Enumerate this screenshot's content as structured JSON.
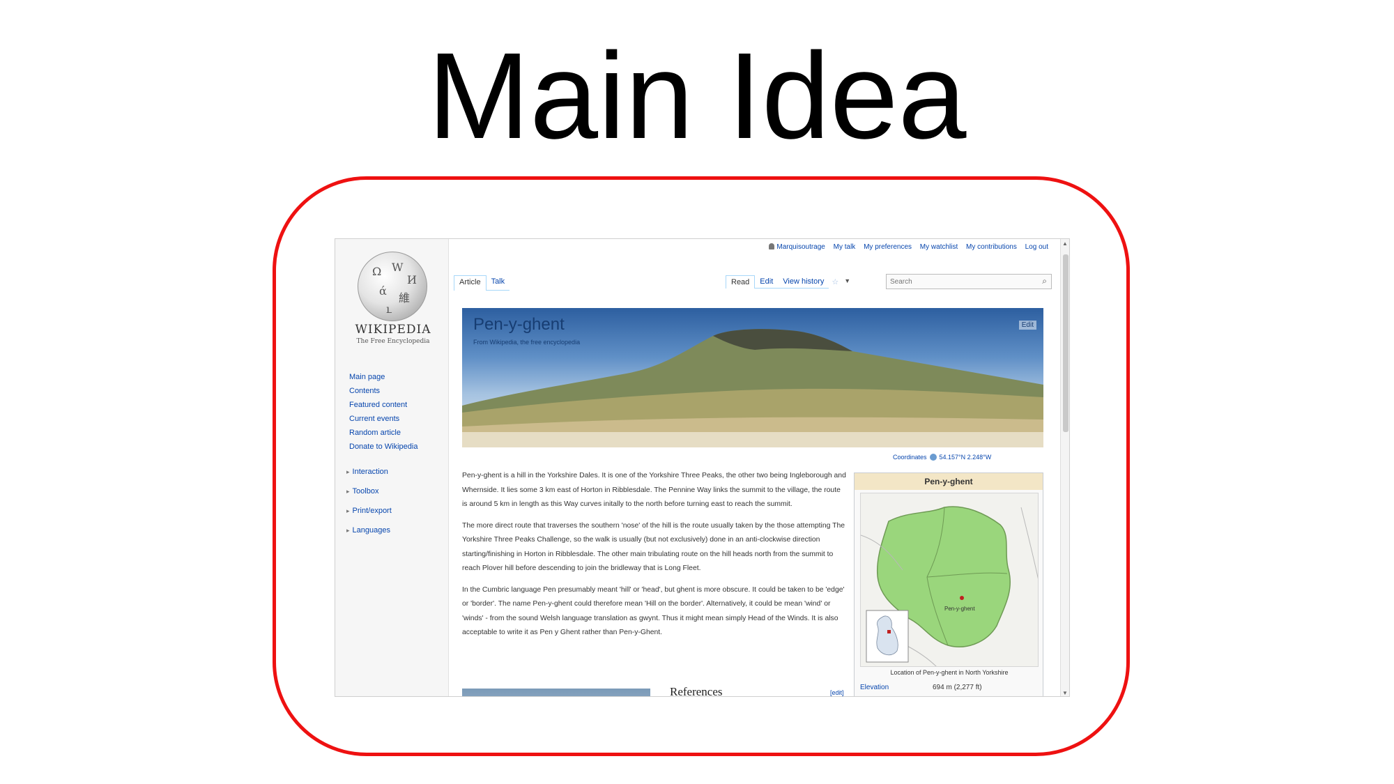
{
  "slide": {
    "title": "Main Idea"
  },
  "sidebar": {
    "logo_word": "WIKIPEDIA",
    "logo_tagline": "The Free Encyclopedia",
    "nav": [
      "Main page",
      "Contents",
      "Featured content",
      "Current events",
      "Random article",
      "Donate to Wikipedia"
    ],
    "portlets": [
      "Interaction",
      "Toolbox",
      "Print/export",
      "Languages"
    ]
  },
  "personal": [
    "Marquisoutrage",
    "My talk",
    "My preferences",
    "My watchlist",
    "My contributions",
    "Log out"
  ],
  "tabs": {
    "article": "Article",
    "talk": "Talk",
    "read": "Read",
    "edit": "Edit",
    "history": "View history"
  },
  "search": {
    "placeholder": "Search"
  },
  "banner": {
    "title": "Pen-y-ghent",
    "subtitle": "From Wikipedia, the free encyclopedia",
    "edit": "Edit"
  },
  "coords": {
    "label": "Coordinates",
    "value": "54.157°N 2.248°W"
  },
  "article": {
    "paragraphs": [
      "Pen-y-ghent is a hill in the Yorkshire Dales. It is one of the Yorkshire Three Peaks, the other two being Ingleborough and Whernside. It lies some 3 km east of Horton in Ribblesdale. The Pennine Way links the summit to the village, the route is around 5 km in length as this Way curves initally to the north before turning east to reach the summit.",
      "The more direct route that traverses the southern 'nose' of the hill is the route usually taken by the those attempting The Yorkshire Three Peaks Challenge, so the walk is usually (but not exclusively) done in an anti-clockwise direction starting/finishing in Horton in Ribblesdale. The other main tribulating route on the hill heads north from the summit to reach Plover hill before descending to join the bridleway that is Long Fleet.",
      "In the Cumbric language Pen presumably meant 'hill' or 'head', but ghent is more obscure. It could be taken to be 'edge' or 'border'. The name Pen-y-ghent could therefore mean 'Hill on the border'. Alternatively, it could be mean 'wind' or 'winds' - from the sound Welsh language translation as gwynt. Thus it might mean simply Head of the Winds. It is also acceptable to write it as Pen y Ghent rather than Pen-y-Ghent."
    ],
    "references_heading": "References",
    "edit_link": "[edit]"
  },
  "infobox": {
    "title": "Pen-y-ghent",
    "map_label": "Pen-y-ghent",
    "caption": "Location of Pen-y-ghent in North Yorkshire",
    "row_key": "Elevation",
    "row_value": "694 m (2,277 ft)"
  },
  "colors": {
    "frame": "#ee1111",
    "link": "#0645ad",
    "map_fill": "#9ad67c"
  }
}
